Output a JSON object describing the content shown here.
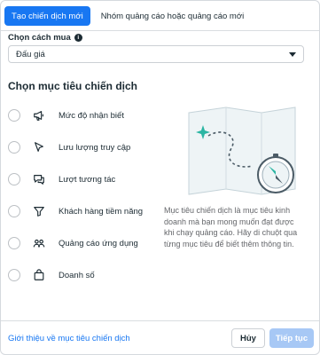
{
  "tabs": [
    {
      "label": "Tạo chiến dịch mới",
      "active": true
    },
    {
      "label": "Nhóm quảng cáo hoặc quảng cáo mới",
      "active": false
    }
  ],
  "buying_type": {
    "label": "Chọn cách mua",
    "info_icon": "i",
    "value": "Đấu giá"
  },
  "objective_section": {
    "title": "Chọn mục tiêu chiến dịch",
    "objectives": [
      {
        "label": "Mức độ nhận biết",
        "icon": "megaphone-icon"
      },
      {
        "label": "Lưu lượng truy cập",
        "icon": "cursor-icon"
      },
      {
        "label": "Lượt tương tác",
        "icon": "chat-bubble-icon"
      },
      {
        "label": "Khách hàng tiềm năng",
        "icon": "filter-icon"
      },
      {
        "label": "Quảng cáo ứng dụng",
        "icon": "people-icon"
      },
      {
        "label": "Doanh số",
        "icon": "shopping-bag-icon"
      }
    ],
    "description": "Mục tiêu chiến dịch là mục tiêu kinh doanh mà bạn mong muốn đạt được khi chạy quảng cáo. Hãy di chuột qua từng mục tiêu để biết thêm thông tin."
  },
  "footer": {
    "link": "Giới thiệu về mục tiêu chiến dịch",
    "cancel": "Hủy",
    "continue": "Tiếp tục"
  },
  "colors": {
    "accent": "#1877f2",
    "disabled_button": "#a7c8f5",
    "illustration_teal": "#2bb5a3"
  }
}
